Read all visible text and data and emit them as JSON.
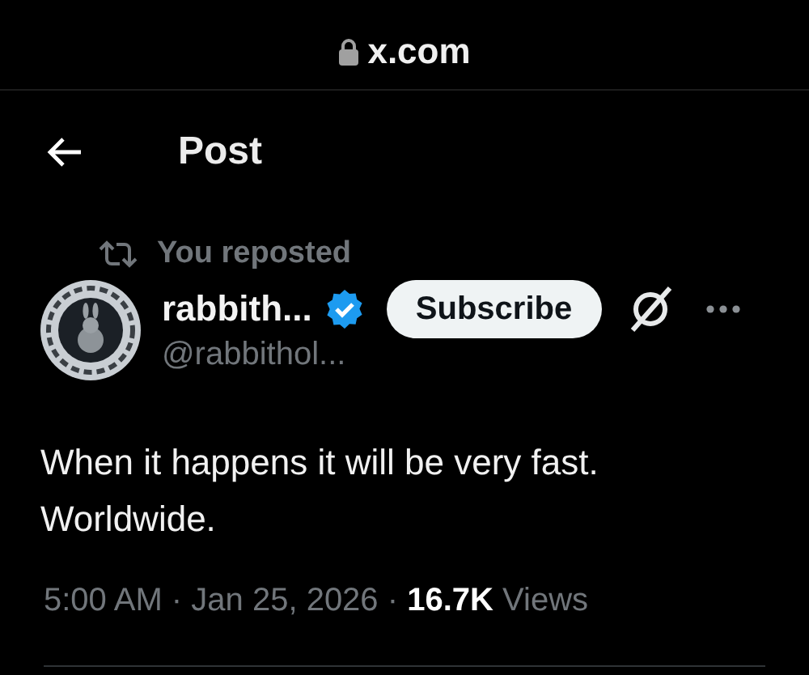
{
  "address_bar": {
    "url": "x.com",
    "secure": true
  },
  "header": {
    "title": "Post"
  },
  "post": {
    "repost_label": "You reposted",
    "author_name": "rabbith...",
    "verified": true,
    "handle": "@rabbithol...",
    "subscribe_label": "Subscribe",
    "text": "When it happens it will be very fast. Worldwide.",
    "meta": "5:00 AM · Jan 25, 2026 · **16.7K** Views"
  }
}
